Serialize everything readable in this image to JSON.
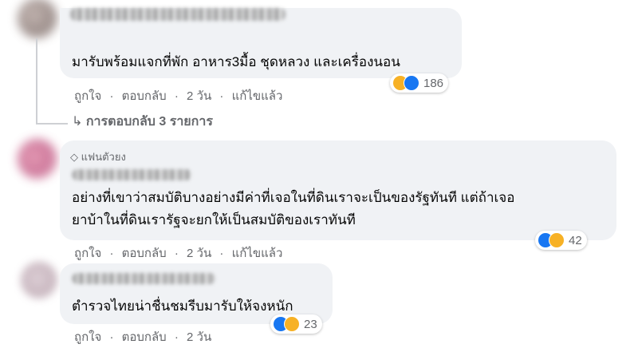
{
  "comments": [
    {
      "text_lines": [
        "มารับพร้อมแจกที่พัก อาหาร3มื้อ ชุดหลวง และเครื่องนอน"
      ],
      "reactions": {
        "icons": [
          "haha-icon",
          "like-icon"
        ],
        "count": "186"
      },
      "actions": {
        "like": "ถูกใจ",
        "reply": "ตอบกลับ",
        "time": "2 วัน",
        "edited": "แก้ไขแล้ว"
      }
    },
    {
      "badge": "แฟนตัวยง",
      "text_lines": [
        "อย่างที่เขาว่าสมบัติบางอย่างมีค่าที่เจอในที่ดินเราจะเป็นของรัฐทันที แต่ถ้าเจอ",
        "ยาบ้าในที่ดินเรารัฐจะยกให้เป็นสมบัติของเราทันที"
      ],
      "reactions": {
        "icons": [
          "like-icon",
          "haha-icon"
        ],
        "count": "42"
      },
      "actions": {
        "like": "ถูกใจ",
        "reply": "ตอบกลับ",
        "time": "2 วัน",
        "edited": "แก้ไขแล้ว"
      }
    },
    {
      "text_lines": [
        "ตำรวจไทยน่าชื่นชมรีบมารับให้จงหนัก"
      ],
      "reactions": {
        "icons": [
          "like-icon",
          "haha-icon"
        ],
        "count": "23"
      },
      "actions": {
        "like": "ถูกใจ",
        "reply": "ตอบกลับ",
        "time": "2 วัน"
      }
    }
  ],
  "replies_link": "การตอบกลับ 3 รายการ",
  "separator": "·",
  "colors": {
    "bubble": "#f0f2f5",
    "meta": "#65676b",
    "like": "#1877f2",
    "haha": "#f7b125"
  }
}
